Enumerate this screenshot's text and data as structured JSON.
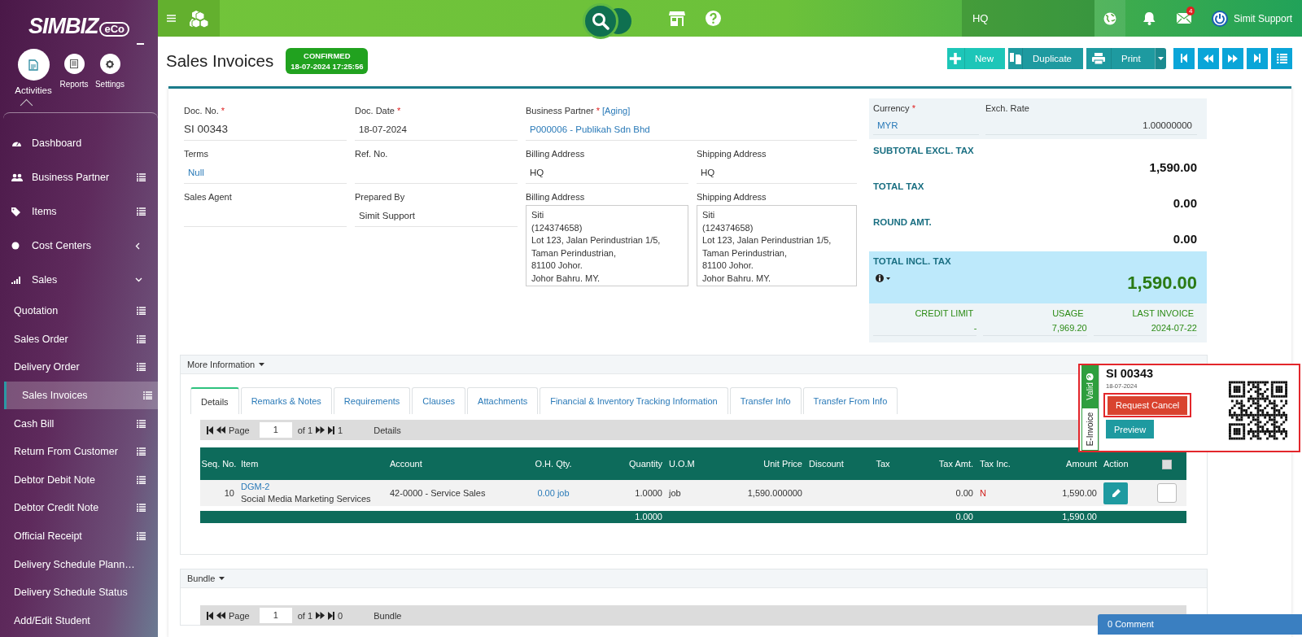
{
  "sidebar": {
    "logo": "SIMBIZ",
    "logo_suffix": "eCo",
    "activities": [
      {
        "label": "Activities",
        "selected": true
      },
      {
        "label": "Reports",
        "selected": false
      },
      {
        "label": "Settings",
        "selected": false
      }
    ],
    "menu": [
      {
        "label": "Dashboard",
        "kind": "link"
      },
      {
        "label": "Business Partner",
        "kind": "list"
      },
      {
        "label": "Items",
        "kind": "list"
      },
      {
        "label": "Cost Centers",
        "kind": "group",
        "expanded": false
      },
      {
        "label": "Sales",
        "kind": "group",
        "expanded": true,
        "children": [
          {
            "label": "Quotation",
            "kind": "list",
            "selected": false
          },
          {
            "label": "Sales Order",
            "kind": "list",
            "selected": false
          },
          {
            "label": "Delivery Order",
            "kind": "list",
            "selected": false
          },
          {
            "label": "Sales Invoices",
            "kind": "list",
            "selected": true
          },
          {
            "label": "Cash Bill",
            "kind": "list",
            "selected": false
          },
          {
            "label": "Return From Customer",
            "kind": "list",
            "selected": false
          },
          {
            "label": "Debtor Debit Note",
            "kind": "list",
            "selected": false
          },
          {
            "label": "Debtor Credit Note",
            "kind": "list",
            "selected": false
          },
          {
            "label": "Official Receipt",
            "kind": "list",
            "selected": false
          },
          {
            "label": "Delivery Schedule Plann…",
            "kind": "link",
            "selected": false
          },
          {
            "label": "Delivery Schedule Status",
            "kind": "link",
            "selected": false
          },
          {
            "label": "Add/Edit Student",
            "kind": "link",
            "selected": false
          }
        ]
      }
    ]
  },
  "topbar": {
    "branch": "HQ",
    "mail_count": "4",
    "user": "Simit Support"
  },
  "header": {
    "title": "Sales Invoices",
    "status": "CONFIRMED",
    "status_time": "18-07-2024 17:25:56"
  },
  "toolbar": [
    {
      "label": "New",
      "kind": "new"
    },
    {
      "label": "Duplicate",
      "kind": "duplicate"
    },
    {
      "label": "Print",
      "kind": "print"
    }
  ],
  "form": {
    "fields": [
      {
        "kind": "text",
        "label": "Doc. No.",
        "required_mark": "*",
        "value": "SI 00343",
        "link": false
      },
      {
        "kind": "text",
        "label": "Doc. Date",
        "required_mark": "*",
        "value": "18-07-2024",
        "link": false
      },
      {
        "kind": "partner",
        "label": "Business Partner",
        "required_mark": "*",
        "tag": "[Aging]",
        "value": "P000006 - Publikah Sdn Bhd",
        "link": true
      },
      {
        "kind": "text",
        "label": "Terms",
        "value": "Null",
        "link": true
      },
      {
        "kind": "text",
        "label": "Ref. No."
      },
      {
        "kind": "text",
        "label": "Billing Address",
        "value": "HQ",
        "link": false
      },
      {
        "kind": "text",
        "label": "Shipping Address",
        "value": "HQ",
        "link": false
      },
      {
        "kind": "text",
        "label": "Sales Agent"
      },
      {
        "kind": "text",
        "label": "Prepared By",
        "value": "Simit Support",
        "link": false
      },
      {
        "kind": "address",
        "label": "Billing Address",
        "lines": [
          "Siti",
          "(124374658)",
          "Lot 123, Jalan Perindustrian 1/5,",
          "Taman Perindustrian,",
          "81100 Johor.",
          "Johor Bahru. MY."
        ]
      },
      {
        "kind": "address",
        "label": "Shipping Address",
        "lines": [
          "Siti",
          "(124374658)",
          "Lot 123, Jalan Perindustrian 1/5,",
          "Taman Perindustrian,",
          "81100 Johor.",
          "Johor Bahru. MY."
        ]
      }
    ]
  },
  "summary": {
    "currency": {
      "label": "Currency",
      "required_mark": "*",
      "value": "MYR"
    },
    "rate": {
      "label": "Exch. Rate",
      "value": "1.00000000"
    },
    "totals": [
      {
        "label": "SUBTOTAL EXCL. TAX",
        "value": "1,590.00"
      },
      {
        "label": "TOTAL TAX",
        "value": "0.00"
      },
      {
        "label": "ROUND AMT.",
        "value": "0.00"
      }
    ],
    "grand": {
      "label": "TOTAL INCL. TAX",
      "value": "1,590.00"
    },
    "credit": [
      {
        "label": "CREDIT LIMIT",
        "value": "-"
      },
      {
        "label": "USAGE",
        "value": "7,969.20"
      },
      {
        "label": "LAST INVOICE",
        "value": "2024-07-22"
      }
    ]
  },
  "details": {
    "title": "More Information",
    "tabs": [
      {
        "label": "Details",
        "selected": true
      },
      {
        "label": "Remarks & Notes",
        "selected": false
      },
      {
        "label": "Requirements",
        "selected": false
      },
      {
        "label": "Clauses",
        "selected": false
      },
      {
        "label": "Attachments",
        "selected": false
      },
      {
        "label": "Financial & Inventory Tracking Information",
        "selected": false
      },
      {
        "label": "Transfer Info",
        "selected": false
      },
      {
        "label": "Transfer From Info",
        "selected": false
      }
    ],
    "pager": {
      "label": "Page",
      "page": "1",
      "of": "of 1",
      "count": "1",
      "caption": "Details"
    },
    "columns": [
      "Seq. No.",
      "Item",
      "Account",
      "O.H. Qty.",
      "Quantity",
      "U.O.M",
      "Unit Price",
      "Discount",
      "Tax",
      "Tax Amt.",
      "Tax Inc.",
      "Amount",
      "Action"
    ],
    "all_checked": false,
    "rows": [
      {
        "seq": "10",
        "code": "DGM-2",
        "description": "Social Media Marketing Services",
        "account": "42-0000 - Service Sales",
        "oh_qty": "0.00 job",
        "quantity": "1.0000",
        "uom": "job",
        "unit_price": "1,590.000000",
        "tax_amt": "0.00",
        "tax_inc": "N",
        "amount": "1,590.00",
        "checked": false
      }
    ],
    "totals": {
      "quantity": "1.0000",
      "tax_amt": "0.00",
      "amount": "1,590.00"
    }
  },
  "bundle": {
    "title": "Bundle",
    "pager": {
      "label": "Page",
      "page": "1",
      "of": "of 1",
      "count": "0",
      "caption": "Bundle"
    }
  },
  "einvoice": {
    "status": "Valid",
    "side_label": "E-Invoice",
    "doc_no": "SI 00343",
    "date": "18-07-2024",
    "cancel": "Request Cancel",
    "preview": "Preview"
  },
  "comments": {
    "label": "0 Comment"
  }
}
